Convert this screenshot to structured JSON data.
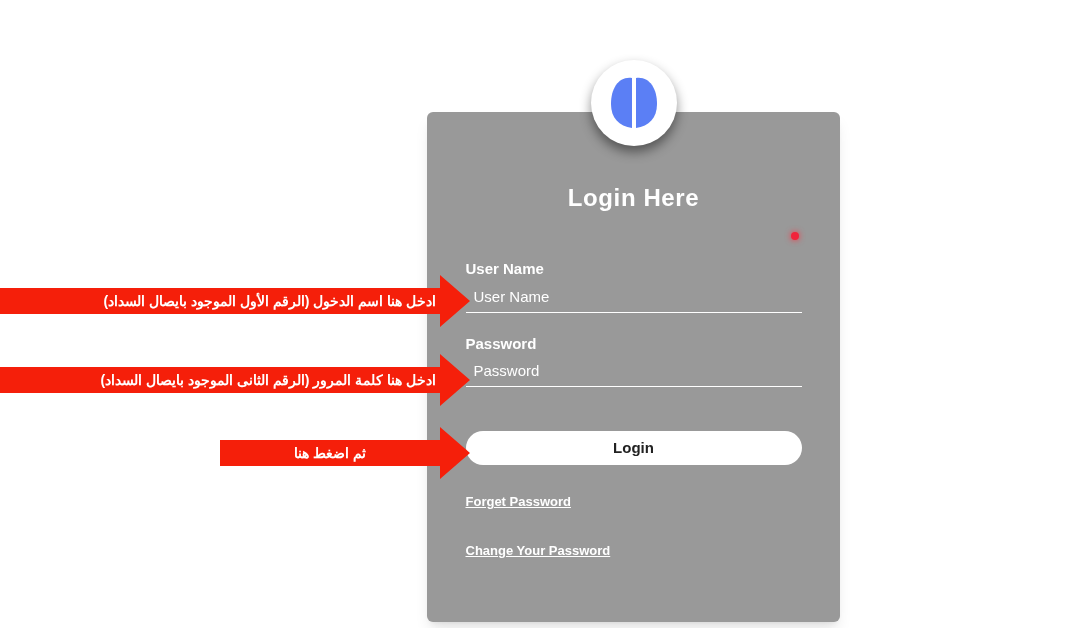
{
  "login_card": {
    "title": "Login Here",
    "fields": [
      {
        "label": "User Name",
        "placeholder": "User Name"
      },
      {
        "label": "Password",
        "placeholder": "Password"
      }
    ],
    "button": "Login",
    "links": [
      "Forget Password",
      "Change Your Password"
    ]
  },
  "annotations": [
    {
      "text": "ادخل هنا اسم الدخول (الرقم الأول الموجود بايصال السداد)"
    },
    {
      "text": "ادخل هنا كلمة المرور (الرقم الثانى الموجود بايصال السداد)"
    },
    {
      "text": "ثم اضغط هنا"
    }
  ]
}
